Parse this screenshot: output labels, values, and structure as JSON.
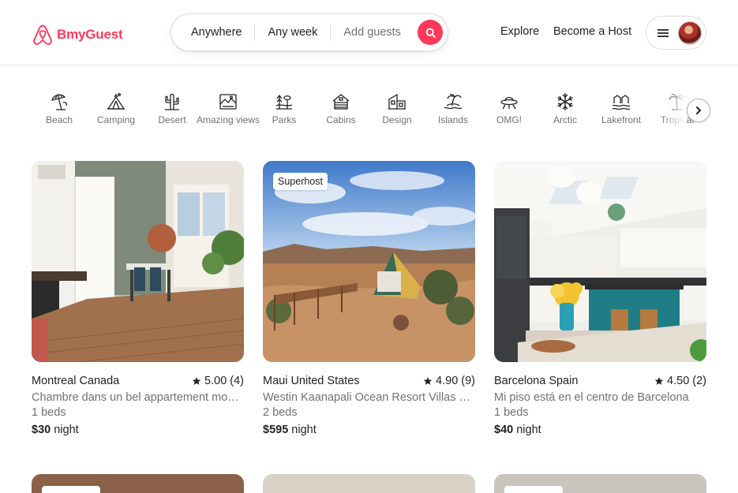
{
  "brand": {
    "name": "BmyGuest",
    "color": "#ff385c"
  },
  "search": {
    "anywhere": "Anywhere",
    "any_week": "Any week",
    "add_guests": "Add guests",
    "button_icon": "search-icon"
  },
  "nav": {
    "explore": "Explore",
    "become_host": "Become a Host",
    "menu_icon": "hamburger-icon"
  },
  "categories": [
    {
      "label": "Beach",
      "icon": "beach-umbrella-icon"
    },
    {
      "label": "Camping",
      "icon": "tent-icon"
    },
    {
      "label": "Desert",
      "icon": "cactus-icon"
    },
    {
      "label": "Amazing views",
      "icon": "landscape-view-icon"
    },
    {
      "label": "Parks",
      "icon": "park-trees-icon"
    },
    {
      "label": "Cabins",
      "icon": "cabin-icon"
    },
    {
      "label": "Design",
      "icon": "design-building-icon"
    },
    {
      "label": "Islands",
      "icon": "island-icon"
    },
    {
      "label": "OMG!",
      "icon": "ufo-icon"
    },
    {
      "label": "Arctic",
      "icon": "snowflake-icon"
    },
    {
      "label": "Lakefront",
      "icon": "lakefront-icon"
    },
    {
      "label": "Tropical",
      "icon": "palm-tree-icon"
    }
  ],
  "listings": [
    {
      "location": "Montreal Canada",
      "rating": "5.00",
      "reviews": "(4)",
      "description": "Chambre dans un bel appartement moderne",
      "beds": "1 beds",
      "price": "$30",
      "price_unit": "night",
      "badge": ""
    },
    {
      "location": "Maui United States",
      "rating": "4.90",
      "reviews": "(9)",
      "description": "Westin Kaanapali Ocean Resort Villas North",
      "beds": "2 beds",
      "price": "$595",
      "price_unit": "night",
      "badge": "Superhost"
    },
    {
      "location": "Barcelona Spain",
      "rating": "4.50",
      "reviews": "(2)",
      "description": "Mi piso está en el centro de Barcelona",
      "beds": "1 beds",
      "price": "$40",
      "price_unit": "night",
      "badge": ""
    }
  ]
}
